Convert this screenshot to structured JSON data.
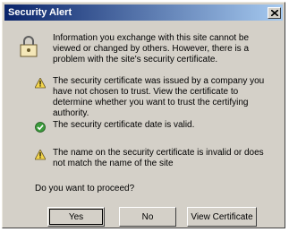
{
  "dialog": {
    "title": "Security Alert",
    "intro": "Information you exchange with this site cannot be viewed or changed by others. However, there is a problem with the site's security certificate.",
    "items": [
      {
        "icon": "warning-icon",
        "text": "The security certificate was issued by a company you have not chosen to trust. View the certificate to determine whether you want to trust the certifying authority."
      },
      {
        "icon": "check-icon",
        "text": "The security certificate date is valid."
      },
      {
        "icon": "warning-icon",
        "text": "The name on the security certificate is invalid or does not match the name of the site"
      }
    ],
    "question": "Do you want to proceed?",
    "buttons": {
      "yes": "Yes",
      "no": "No",
      "view_certificate": "View Certificate"
    }
  }
}
